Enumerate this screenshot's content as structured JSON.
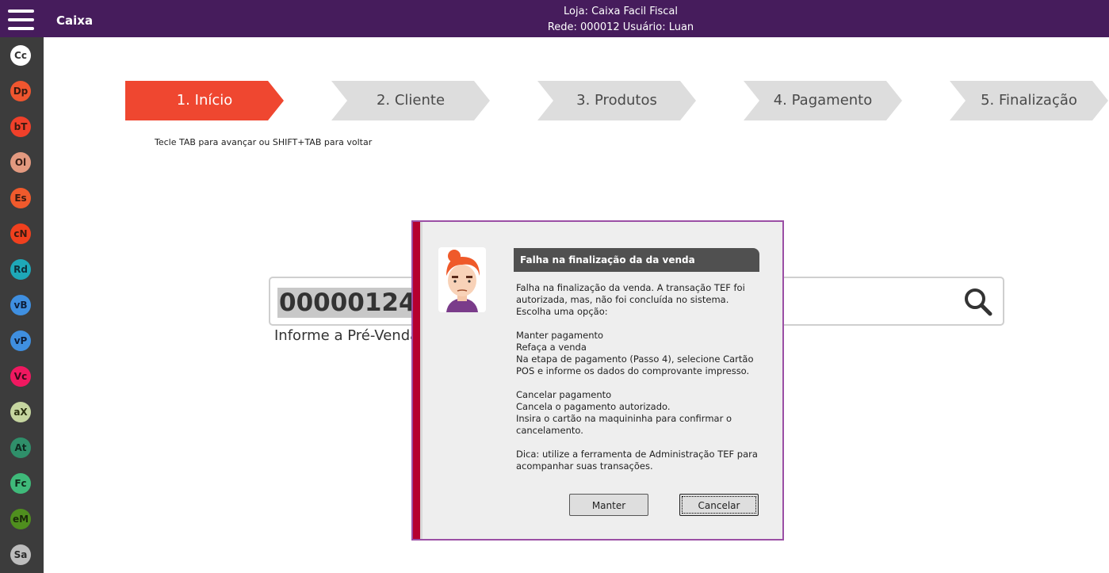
{
  "header": {
    "app_title": "Caixa",
    "store_line": "Loja: Caixa  Facil Fiscal",
    "network_line": "Rede: 000012 Usuário: Luan"
  },
  "sidebar": {
    "items": [
      {
        "label": "Cc",
        "bg": "#ffffff",
        "fg": "#333333"
      },
      {
        "label": "Dp",
        "bg": "#f0562f",
        "fg": "#3a1a10"
      },
      {
        "label": "bT",
        "bg": "#f0402a",
        "fg": "#3a1a10"
      },
      {
        "label": "Ol",
        "bg": "#e39a80",
        "fg": "#3a2018"
      },
      {
        "label": "Es",
        "bg": "#f05a2c",
        "fg": "#3a1a10"
      },
      {
        "label": "cN",
        "bg": "#f0401e",
        "fg": "#3a1a10"
      },
      {
        "label": "Rd",
        "bg": "#1ea8b8",
        "fg": "#0f2f3a"
      },
      {
        "label": "vB",
        "bg": "#3f8fe0",
        "fg": "#0f1f3a"
      },
      {
        "label": "vP",
        "bg": "#3f8fe0",
        "fg": "#0f1f3a"
      },
      {
        "label": "Vc",
        "bg": "#f01860",
        "fg": "#3a0a1a"
      },
      {
        "label": "aX",
        "bg": "#c6d6a0",
        "fg": "#2a3010"
      },
      {
        "label": "At",
        "bg": "#2f8f6a",
        "fg": "#0f2a20"
      },
      {
        "label": "Fc",
        "bg": "#3fba7a",
        "fg": "#0f2a1a"
      },
      {
        "label": "eM",
        "bg": "#4f8f1e",
        "fg": "#1a2a0a"
      },
      {
        "label": "Sa",
        "bg": "#bdbdbd",
        "fg": "#2a2a2a"
      }
    ]
  },
  "steps": [
    {
      "label": "1. Início"
    },
    {
      "label": "2. Cliente"
    },
    {
      "label": "3. Produtos"
    },
    {
      "label": "4. Pagamento"
    },
    {
      "label": "5. Finalização"
    }
  ],
  "hint": "Tecle TAB para avançar ou SHIFT+TAB para voltar",
  "search": {
    "value": "00000124-",
    "label": "Informe a Pré-Venda"
  },
  "dialog": {
    "title": "Falha na finalização da da venda",
    "body": [
      "Falha na finalização da venda. A transação TEF foi autorizada, mas, não foi concluída no sistema.",
      "Escolha uma opção:",
      "",
      "Manter pagamento",
      "Refaça a venda",
      "Na etapa de pagamento (Passo 4), selecione Cartão POS e informe os dados do comprovante impresso.",
      "",
      "Cancelar pagamento",
      "Cancela o pagamento autorizado.",
      "Insira o cartão na maquininha para confirmar o cancelamento.",
      "",
      "Dica: utilize a ferramenta de Administração TEF para acompanhar suas transações."
    ],
    "buttons": {
      "keep": "Manter",
      "cancel": "Cancelar"
    }
  },
  "colors": {
    "header_bg": "#461c5c",
    "active_step": "#ef4730",
    "dialog_border": "#9b4fa5",
    "dialog_accent": "#b5002f"
  }
}
